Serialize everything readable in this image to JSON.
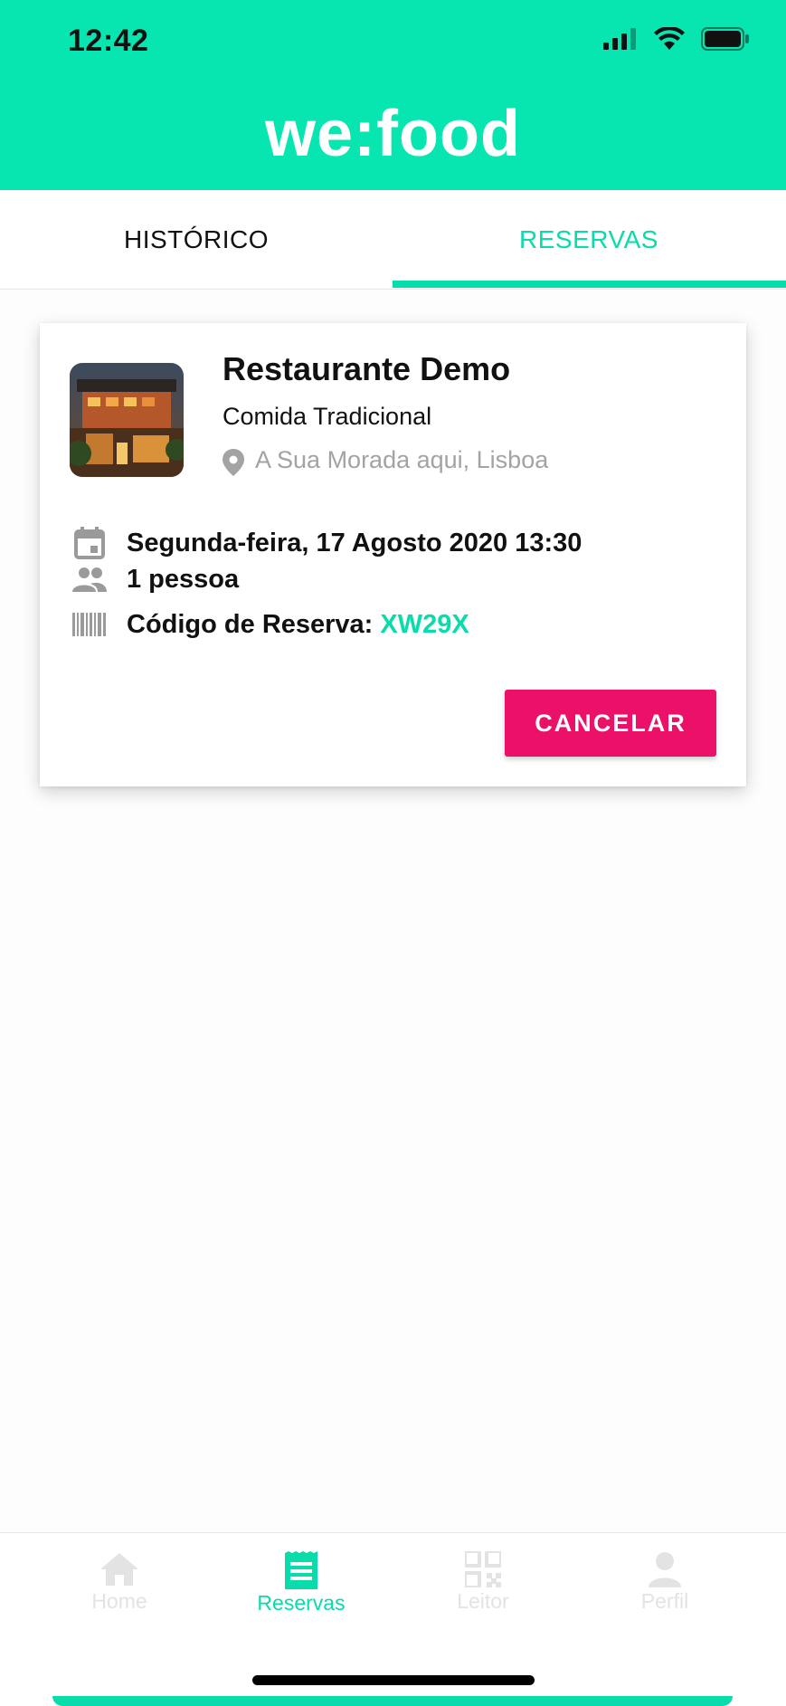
{
  "status_bar": {
    "time": "12:42"
  },
  "header": {
    "logo": "we:food",
    "bg_color": "#07e6b0"
  },
  "tabs": [
    {
      "label": "HISTÓRICO",
      "active": false
    },
    {
      "label": "RESERVAS",
      "active": true
    }
  ],
  "reservation": {
    "restaurant_name": "Restaurante Demo",
    "restaurant_type": "Comida Tradicional",
    "address": "A Sua Morada aqui, Lisboa",
    "datetime": "Segunda-feira, 17 Agosto 2020 13:30",
    "people": "1 pessoa",
    "code_label": "Código de Reserva:",
    "code_value": "XW29X",
    "cancel_label": "CANCELAR"
  },
  "bottom_nav": [
    {
      "label": "Home",
      "icon": "home-icon",
      "active": false
    },
    {
      "label": "Reservas",
      "icon": "reservations-icon",
      "active": true
    },
    {
      "label": "Leitor",
      "icon": "qr-code-icon",
      "active": false
    },
    {
      "label": "Perfil",
      "icon": "profile-icon",
      "active": false
    }
  ],
  "colors": {
    "accent": "#07dcaa",
    "cancel": "#ec1168",
    "muted": "#a3a3a3"
  }
}
